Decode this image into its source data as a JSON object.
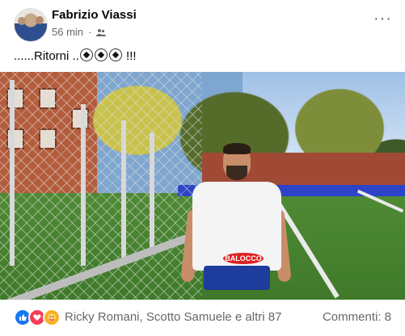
{
  "post": {
    "author": "Fabrizio Viassi",
    "time": "56 min",
    "separator": "·",
    "audience_icon": "friends-icon",
    "text_before": "......Ritorni ..",
    "text_after": " !!!",
    "emoji": [
      "soccer-ball-icon",
      "soccer-ball-icon",
      "soccer-ball-icon"
    ],
    "photo": {
      "sponsor_text": "BALOCCO"
    }
  },
  "footer": {
    "reactions": [
      "like-icon",
      "love-icon",
      "care-icon"
    ],
    "reaction_names": "Ricky Romani, Scotto Samuele e altri 87",
    "comments": "Commenti: 8"
  },
  "colors": {
    "text_primary": "#050505",
    "text_secondary": "#65676b",
    "like": "#1877f2",
    "love": "#f33e58",
    "care": "#f7b125"
  }
}
